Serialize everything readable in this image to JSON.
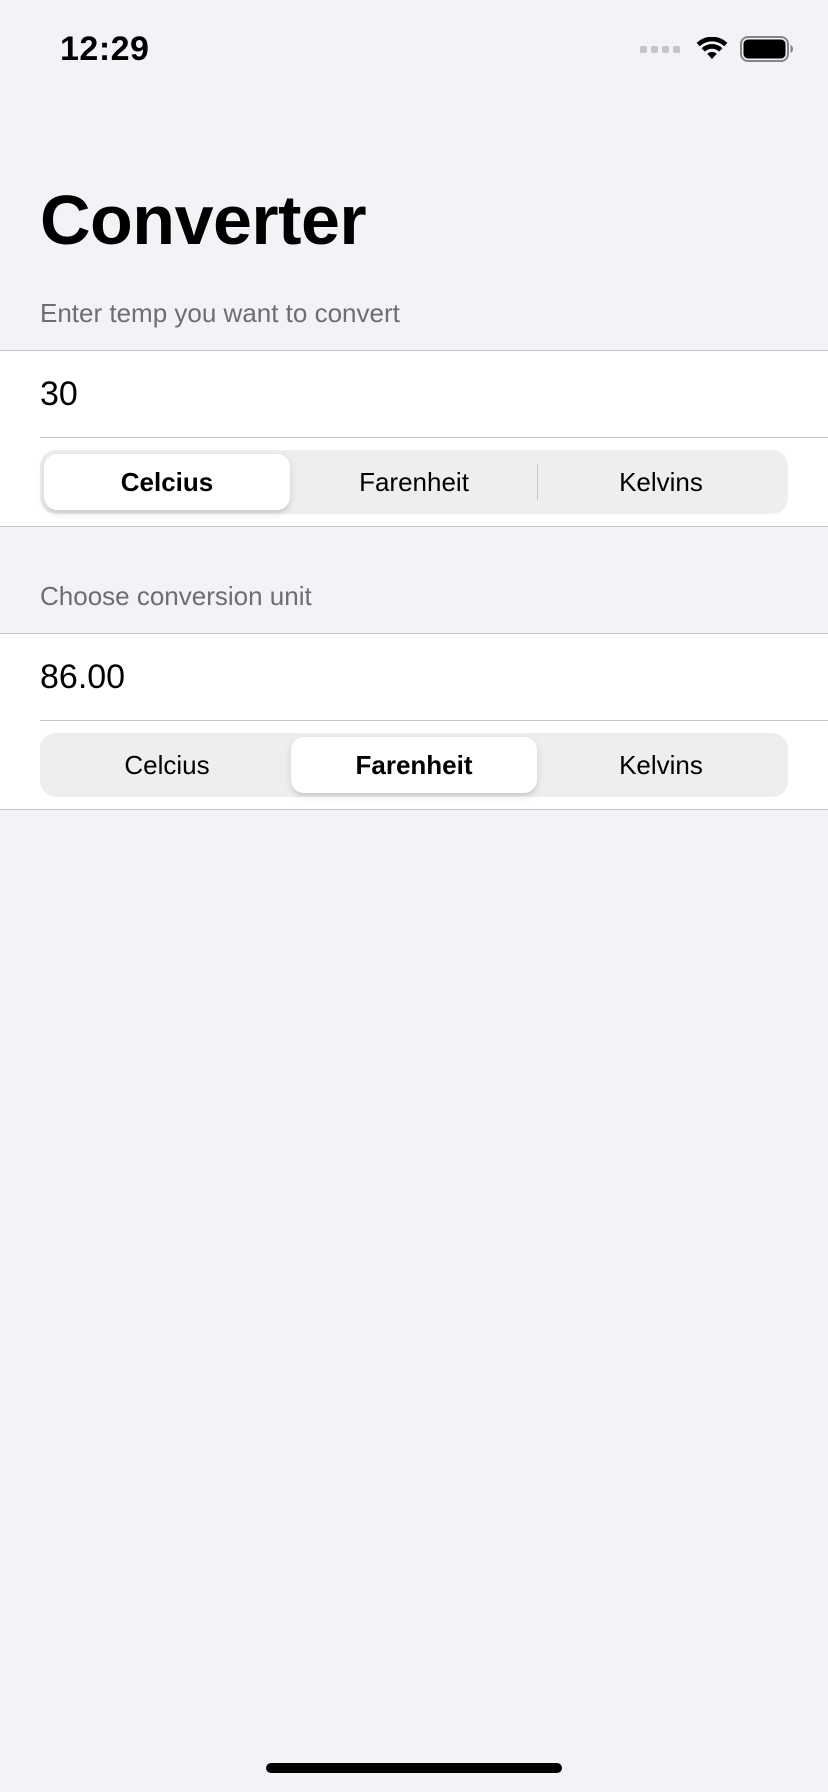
{
  "status_bar": {
    "time": "12:29",
    "icons": [
      "cellular-signal-icon",
      "wifi-icon",
      "battery-icon"
    ]
  },
  "title": "Converter",
  "input_section": {
    "header": "Enter temp you want to convert",
    "value": "30",
    "units": [
      "Celcius",
      "Farenheit",
      "Kelvins"
    ],
    "selected_unit": "Celcius"
  },
  "output_section": {
    "header": "Choose conversion unit",
    "value": "86.00",
    "units": [
      "Celcius",
      "Farenheit",
      "Kelvins"
    ],
    "selected_unit": "Farenheit"
  },
  "colors": {
    "background": "#f2f2f7",
    "cell": "#ffffff",
    "secondary_text": "#6d6d72",
    "separator": "#c6c6c8",
    "segment_track": "#eeeeef"
  }
}
